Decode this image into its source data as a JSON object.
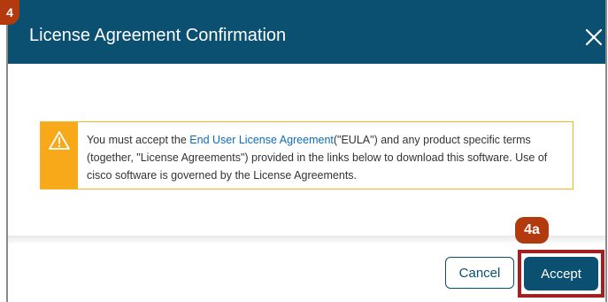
{
  "dialog": {
    "title": "License Agreement Confirmation",
    "close_icon": "close-icon"
  },
  "annotations": {
    "step_badge": "4",
    "sub_step_badge": "4a",
    "highlight_color": "#a31f22"
  },
  "notice": {
    "icon": "warning-icon",
    "text_before_link": "You must accept the ",
    "link_text": "End User License Agreement",
    "text_after_link": "(\"EULA\") and any product specific terms (together, \"License Agreements\") provided in the links below to download this software. Use of cisco software is governed by the License Agreements."
  },
  "footer": {
    "cancel_label": "Cancel",
    "accept_label": "Accept"
  },
  "colors": {
    "header_bg": "#0b4f71",
    "notice_accent": "#f7a91a",
    "link": "#0b6dba",
    "badge": "#b23a0e"
  }
}
